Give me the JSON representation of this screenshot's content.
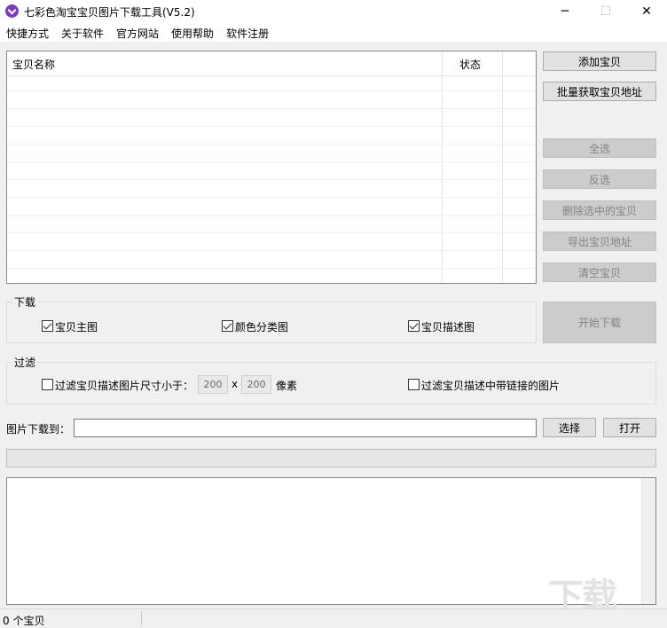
{
  "window": {
    "title": "七彩色淘宝宝贝图片下载工具(V5.2)",
    "minimize_glyph": "─",
    "maximize_glyph": "☐",
    "close_glyph": "✕"
  },
  "menu": [
    "快捷方式",
    "关于软件",
    "官方网站",
    "使用帮助",
    "软件注册"
  ],
  "list": {
    "col_name": "宝贝名称",
    "col_status": "状态"
  },
  "buttons": {
    "add": "添加宝贝",
    "batch": "批量获取宝贝地址",
    "select_all": "全选",
    "invert": "反选",
    "delete_selected": "删除选中的宝贝",
    "export": "导出宝贝地址",
    "clear": "清空宝贝",
    "start": "开始下载",
    "choose": "选择",
    "open": "打开"
  },
  "download_group": {
    "label": "下载",
    "main_image": "宝贝主图",
    "color_image": "颜色分类图",
    "desc_image": "宝贝描述图"
  },
  "filter_group": {
    "label": "过滤",
    "size_filter": "过滤宝贝描述图片尺寸小于：",
    "width": "200",
    "times": "x",
    "height": "200",
    "unit": "像素",
    "link_filter": "过滤宝贝描述中带链接的图片"
  },
  "save": {
    "label": "图片下载到：",
    "path": ""
  },
  "status": {
    "count": "0 个宝贝"
  },
  "watermark": "下载"
}
